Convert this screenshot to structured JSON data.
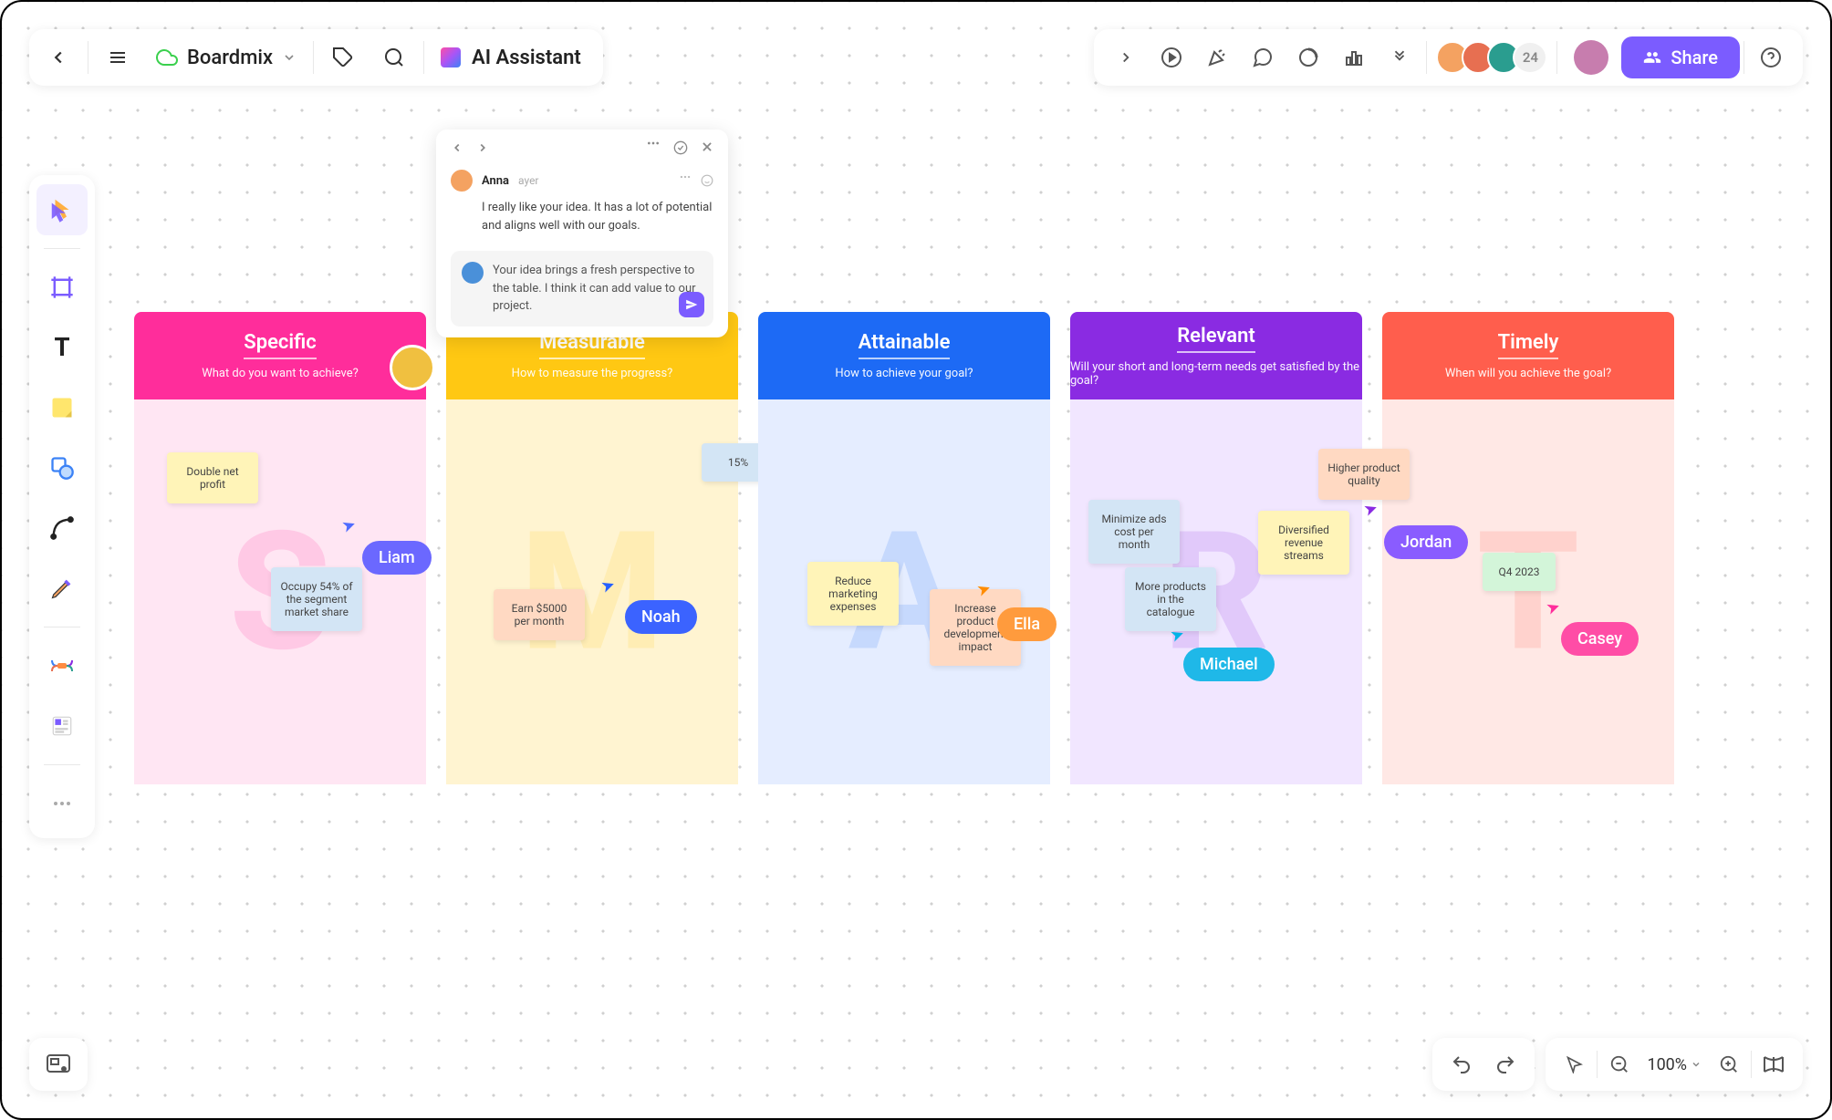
{
  "header": {
    "board_title": "Boardmix",
    "ai_label": "AI Assistant",
    "avatar_count": "24",
    "share_label": "Share"
  },
  "comment": {
    "author": "Anna",
    "time": "ayer",
    "text": "I really like your idea. It has a lot of potential and aligns well with our goals.",
    "reply": "Your idea brings a fresh perspective to the table. I think it can add value to our project."
  },
  "columns": [
    {
      "title": "Specific",
      "sub": "What do you want to achieve?",
      "letter": "S",
      "header_bg": "#ff2d9b",
      "body_bg": "#ffe6f3",
      "wm_color": "#ff2d9b"
    },
    {
      "title": "Measurable",
      "sub": "How to measure the progress?",
      "letter": "M",
      "header_bg": "#ffc813",
      "body_bg": "#fff4d1",
      "wm_color": "#ffc813"
    },
    {
      "title": "Attainable",
      "sub": "How to achieve your goal?",
      "letter": "A",
      "header_bg": "#1d6af5",
      "body_bg": "#e5edff",
      "wm_color": "#1d6af5"
    },
    {
      "title": "Relevant",
      "sub": "Will your short and long-term needs get satisfied by the goal?",
      "letter": "R",
      "header_bg": "#8a2be2",
      "body_bg": "#f1e6ff",
      "wm_color": "#8a2be2"
    },
    {
      "title": "Timely",
      "sub": "When will you achieve the goal?",
      "letter": "T",
      "header_bg": "#ff5e4d",
      "body_bg": "#ffe8e5",
      "wm_color": "#ff5e4d"
    }
  ],
  "notes": {
    "s1": "Double net profit",
    "s2": "Occupy 54% of the segment market share",
    "m1": "Earn $5000 per month",
    "a0": "15%",
    "a1": "Reduce marketing expenses",
    "a2": "Increase product development impact",
    "r1": "Minimize ads cost per month",
    "r2": "More products in the catalogue",
    "r3": "Diversified revenue streams",
    "t1": "Higher product quality",
    "t2": "Q4 2023"
  },
  "cursors": {
    "liam": "Liam",
    "noah": "Noah",
    "ella": "Ella",
    "michael": "Michael",
    "jordan": "Jordan",
    "casey": "Casey"
  },
  "zoom": "100%"
}
